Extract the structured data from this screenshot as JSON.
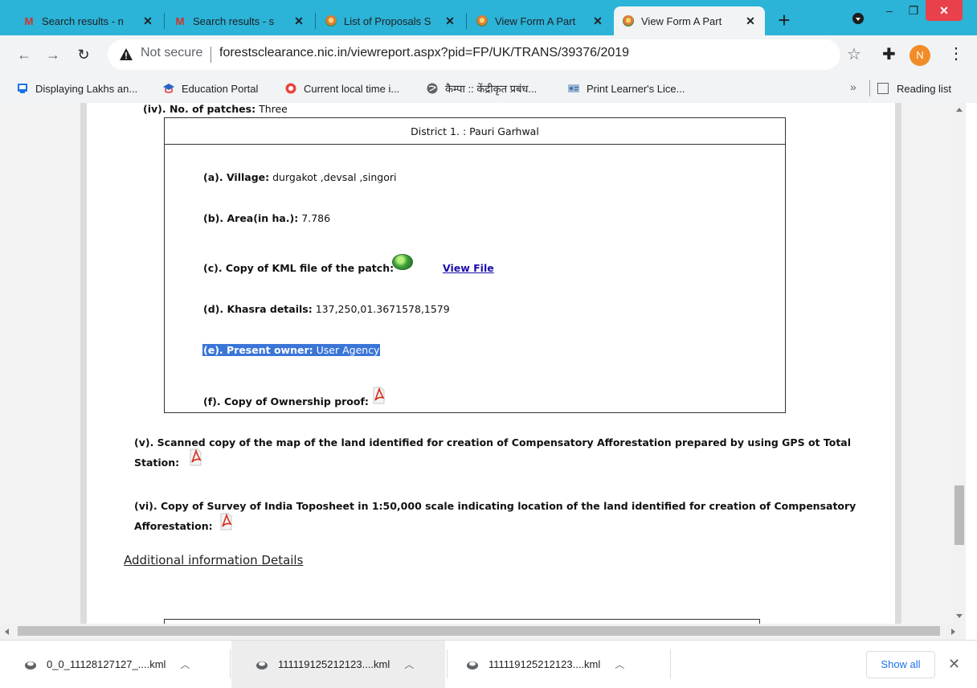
{
  "browser": {
    "tabs": [
      {
        "title": "Search results - n",
        "favicon": "gmail-icon"
      },
      {
        "title": "Search results - s",
        "favicon": "gmail-icon"
      },
      {
        "title": "List of Proposals S",
        "favicon": "emblem-icon"
      },
      {
        "title": "View Form A Part",
        "favicon": "emblem-icon"
      },
      {
        "title": "View Form A Part",
        "favicon": "emblem-icon",
        "active": true
      }
    ],
    "new_tab": "+",
    "omnibox": {
      "security": "Not secure",
      "url": "forestsclearance.nic.in/viewreport.aspx?pid=FP/UK/TRANS/39376/2019"
    },
    "avatar_letter": "N",
    "bookmarks": [
      {
        "label": "Displaying Lakhs an...",
        "icon": "tv-icon"
      },
      {
        "label": "Education Portal",
        "icon": "education-icon"
      },
      {
        "label": "Current local time i...",
        "icon": "clock-icon"
      },
      {
        "label": "कैम्पा :: केंद्रीकृत प्रबंध...",
        "icon": "globe-icon"
      },
      {
        "label": "Print Learner's Lice...",
        "icon": "license-icon"
      }
    ],
    "bookmarks_overflow": "»",
    "reading_list": "Reading list"
  },
  "page": {
    "patches_heading_label": "(iv). No. of patches:",
    "patches_heading_value": "Three",
    "district_header": "District 1. : Pauri Garhwal",
    "village_label": "(a). Village:",
    "village_value": "durgakot ,devsal ,singori",
    "area_label": "(b). Area(in ha.):",
    "area_value": "7.786",
    "kml_label": "(c). Copy of KML file of the patch:",
    "kml_link": "View File",
    "khasra_label": "(d). Khasra details:",
    "khasra_value": "137,250,01.3671578,1579",
    "owner_label": "(e). Present owner:",
    "owner_value": "User Agency",
    "ownership_proof_label": "(f). Copy of Ownership proof:",
    "item_v_line1": "(v). Scanned copy of the map of the land identified for creation of Compensatory Afforestation prepared by using GPS ot Total",
    "item_v_line2": "Station:",
    "item_vi_line1": "(vi). Copy of Survey of India Toposheet in 1:50,000 scale indicating location of the land identified for creation of Compensatory",
    "item_vi_line2": "Afforestation:",
    "additional_info": "Additional information Details"
  },
  "downloads": [
    {
      "filename": "0_0_11128127127_....kml"
    },
    {
      "filename": "111119125212123....kml"
    },
    {
      "filename": "111119125212123....kml"
    }
  ],
  "show_all": "Show all",
  "colors": {
    "tabstrip": "#2bb3d8",
    "selection": "#3a75d8",
    "link": "#1a0dab"
  }
}
